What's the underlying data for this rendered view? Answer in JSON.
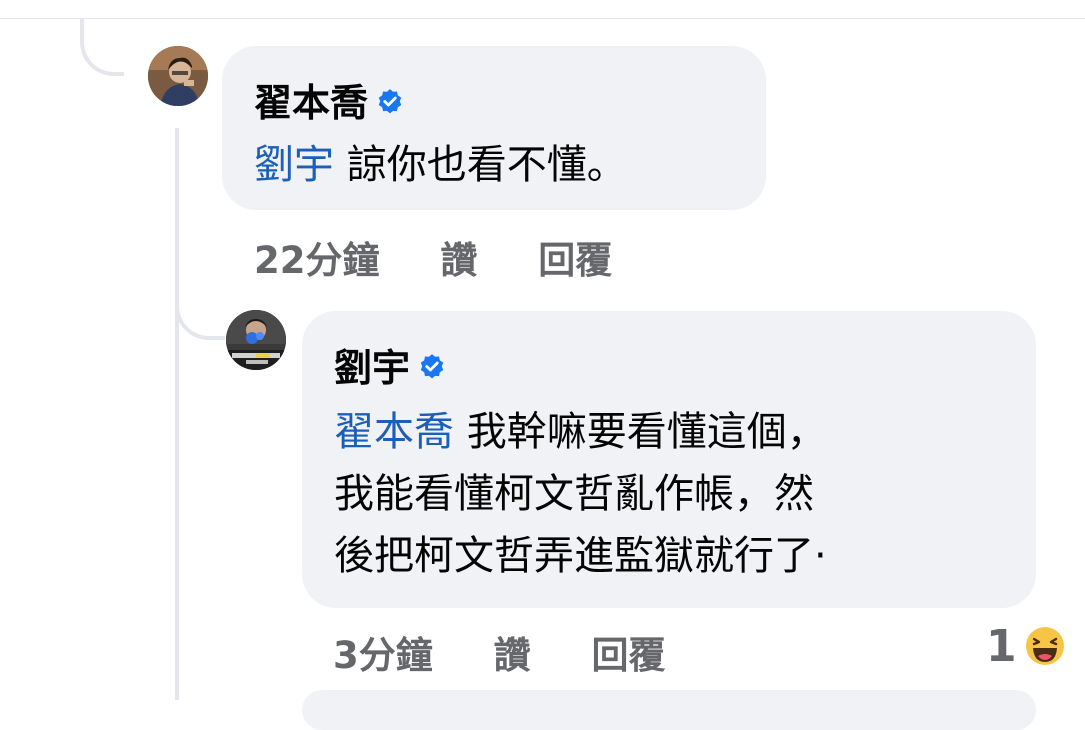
{
  "comments": [
    {
      "author": "翟本喬",
      "mention": "劉宇",
      "lines": [
        "諒你也看不懂。"
      ],
      "time": "22分鐘",
      "like_label": "讚",
      "reply_label": "回覆"
    },
    {
      "author": "劉宇",
      "mention": "翟本喬",
      "lines": [
        "我幹嘛要看懂這個，",
        "我能看懂柯文哲亂作帳，然",
        "後把柯文哲弄進監獄就行了·"
      ],
      "time": "3分鐘",
      "like_label": "讚",
      "reply_label": "回覆",
      "reaction_count": "1",
      "reaction_icon": "haha-emoji-icon"
    }
  ],
  "colors": {
    "bubble": "#f0f2f5",
    "mention": "#1c5fb8",
    "meta_text": "#65676b",
    "verified": "#1877f2"
  }
}
